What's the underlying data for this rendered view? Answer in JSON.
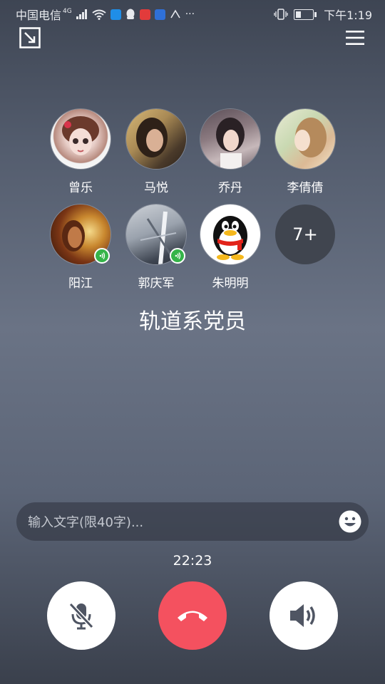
{
  "status_bar": {
    "carrier": "中国电信",
    "network": "4G",
    "time": "下午1:19"
  },
  "members": [
    {
      "name": "曾乐",
      "speaking": false
    },
    {
      "name": "马悦",
      "speaking": false
    },
    {
      "name": "乔丹",
      "speaking": false
    },
    {
      "name": "李倩倩",
      "speaking": false
    },
    {
      "name": "阳江",
      "speaking": true
    },
    {
      "name": "郭庆军",
      "speaking": true
    },
    {
      "name": "朱明明",
      "speaking": false
    }
  ],
  "more_count": "7+",
  "group_title": "轨道系党员",
  "message_input": {
    "placeholder": "输入文字(限40字)...",
    "value": ""
  },
  "call_duration": "22:23",
  "colors": {
    "hangup": "#f4515f",
    "speaking": "#35b449"
  },
  "icons": {
    "minimize": "minimize-window-icon",
    "menu": "hamburger-menu-icon",
    "emoji": "smiley-icon",
    "mute": "microphone-muted-icon",
    "hangup": "phone-hangup-icon",
    "speaker": "speaker-volume-icon"
  }
}
